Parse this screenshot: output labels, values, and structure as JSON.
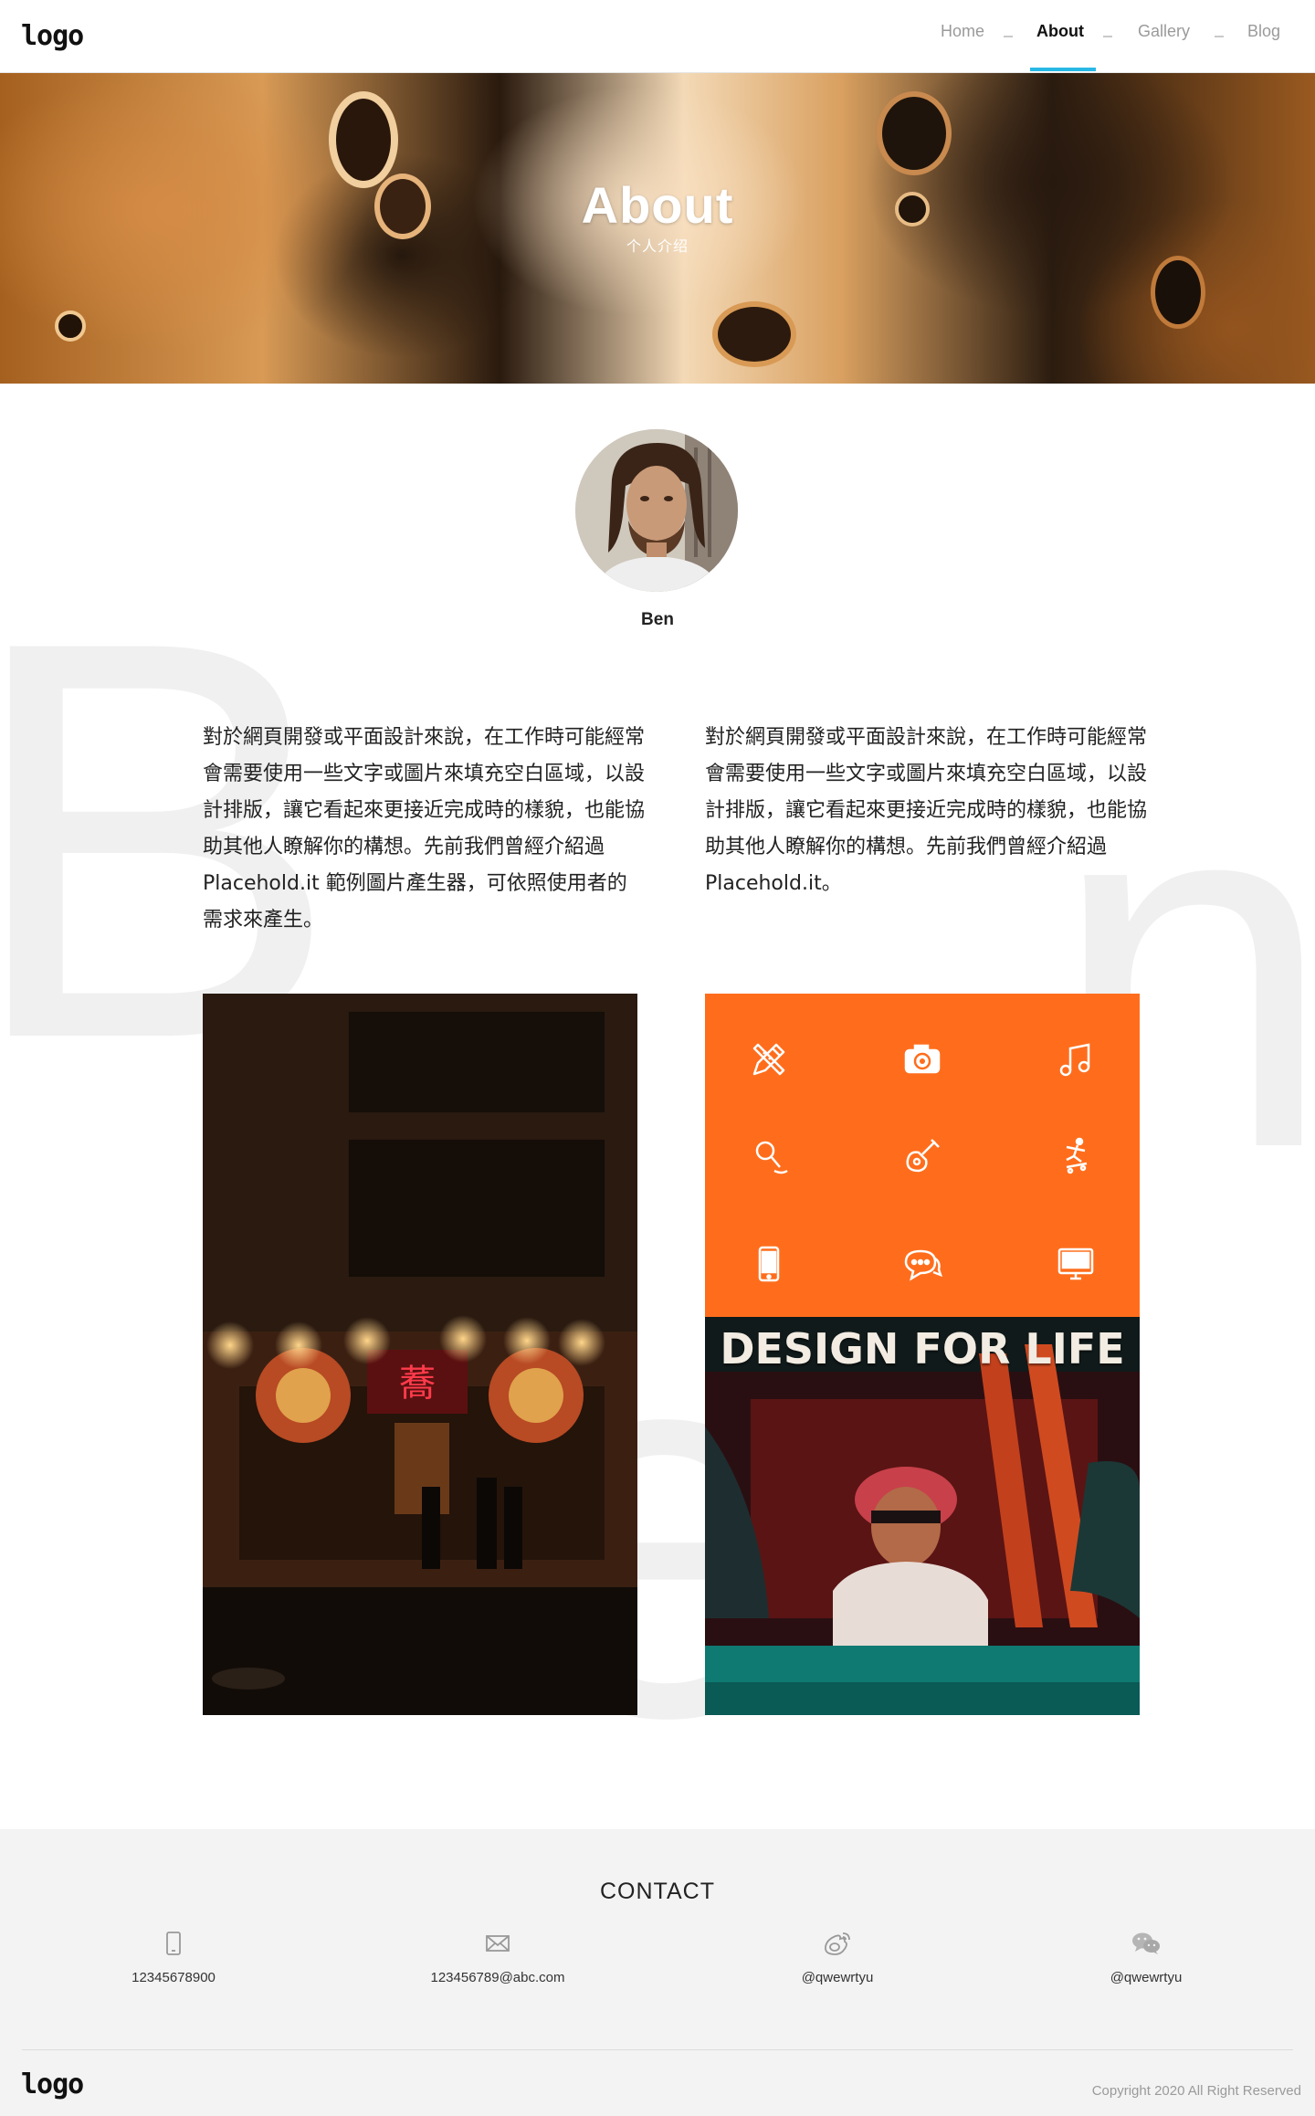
{
  "header": {
    "logo": "logo",
    "nav": [
      {
        "label": "Home"
      },
      {
        "label": "About",
        "active": true
      },
      {
        "label": "Gallery"
      },
      {
        "label": "Blog"
      }
    ],
    "accent_color": "#27b8e5"
  },
  "hero": {
    "title": "About",
    "subtitle": "个人介绍"
  },
  "background_letters": [
    "B",
    "e",
    "n"
  ],
  "profile": {
    "name": "Ben",
    "paragraphs": [
      "對於網頁開發或平面設計來說，在工作時可能經常會需要使用一些文字或圖片來填充空白區域，以設計排版，讓它看起來更接近完成時的樣貌，也能協助其他人瞭解你的構想。先前我們曾經介紹過 Placehold.it 範例圖片產生器，可依照使用者的需求來產生。",
      "對於網頁開發或平面設計來說，在工作時可能經常會需要使用一些文字或圖片來填充空白區域，以設計排版，讓它看起來更接近完成時的樣貌，也能協助其他人瞭解你的構想。先前我們曾經介紹過 Placehold.it。"
    ]
  },
  "gallery": {
    "panel_color": "#ff6d1c",
    "icons": [
      "pencil-ruler-icon",
      "camera-icon",
      "music-note-icon",
      "microphone-icon",
      "guitar-icon",
      "skateboarder-icon",
      "mobile-phone-icon",
      "chat-bubble-icon",
      "monitor-icon"
    ],
    "poster_text": "DESIGN FOR LIFE"
  },
  "footer": {
    "contact_title": "CONTACT",
    "contacts": [
      {
        "icon": "phone-icon",
        "text": "12345678900"
      },
      {
        "icon": "mail-icon",
        "text": "123456789@abc.com"
      },
      {
        "icon": "weibo-icon",
        "text": "@qwewrtyu"
      },
      {
        "icon": "wechat-icon",
        "text": "@qwewrtyu"
      }
    ],
    "logo": "logo",
    "copyright": "Copyright 2020 All Right Reserved"
  }
}
